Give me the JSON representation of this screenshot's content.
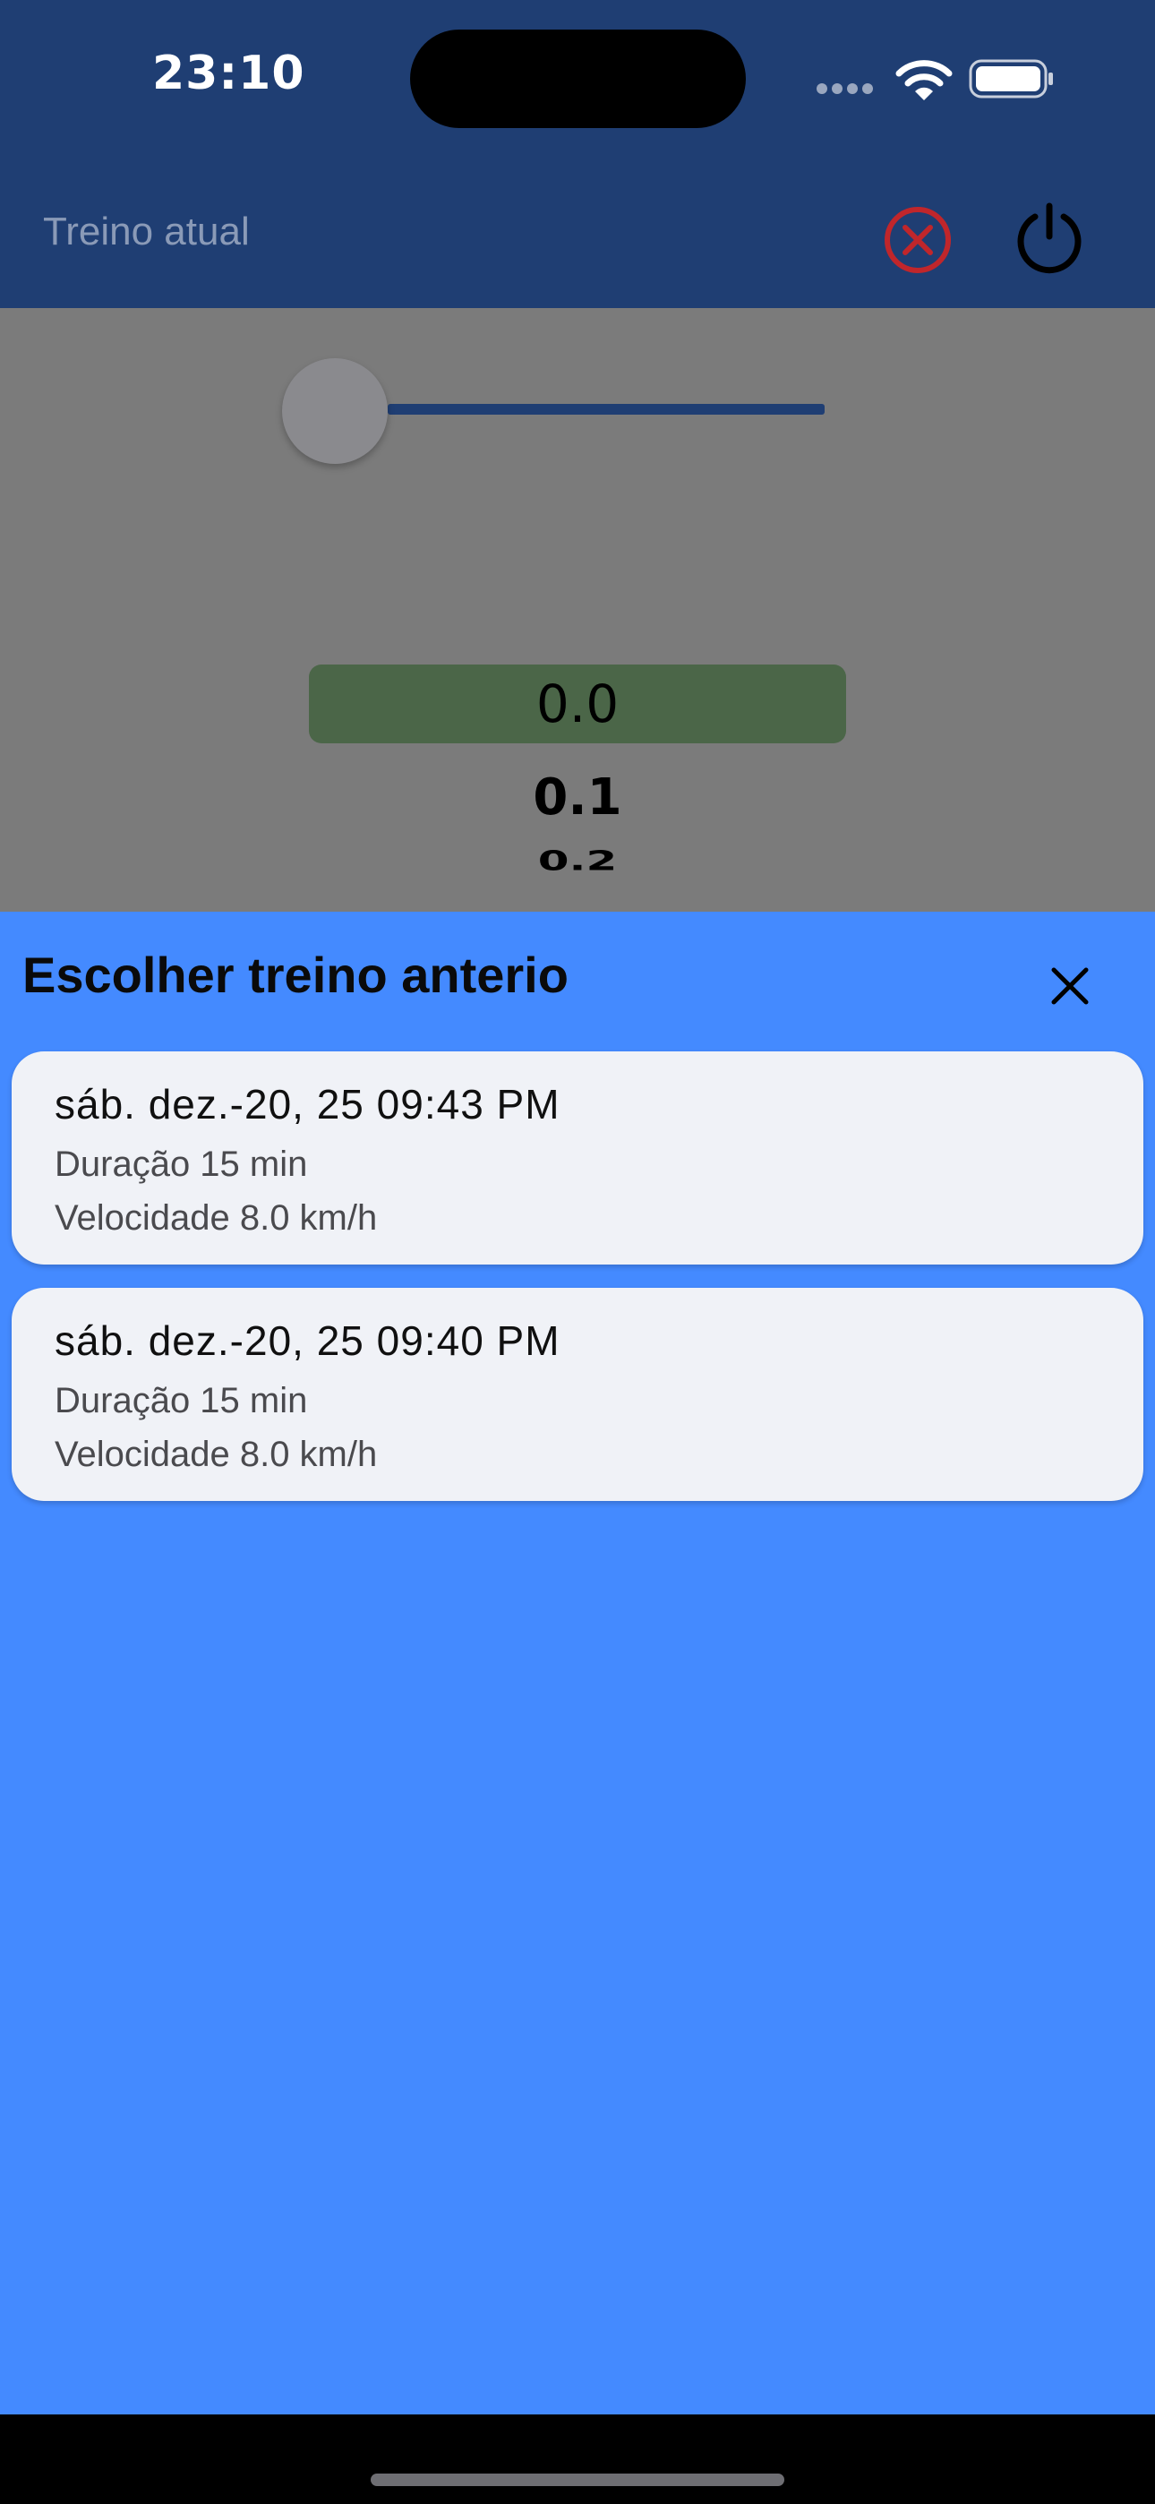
{
  "status_bar": {
    "time": "23:10"
  },
  "header": {
    "title": "Treino atual"
  },
  "picker": {
    "selected": "0.0",
    "next": "0.1",
    "next2": "0.2"
  },
  "sheet": {
    "title": "Escolher treino anterio",
    "workouts": [
      {
        "date": "sáb. dez.-20, 25 09:43 PM",
        "duration": "Duração 15 min",
        "speed": "Velocidade 8.0 km/h"
      },
      {
        "date": "sáb. dez.-20, 25 09:40 PM",
        "duration": "Duração 15 min",
        "speed": "Velocidade 8.0 km/h"
      }
    ]
  },
  "colors": {
    "header_bg": "#1f3e73",
    "sheet_bg": "#448aff",
    "card_bg": "#f0f2f7",
    "cancel_red": "#c0262b",
    "picker_selected_bg": "#4b6648"
  },
  "icons": {
    "wifi": "wifi-icon",
    "battery": "battery-icon",
    "cancel": "cancel-circle-icon",
    "power": "power-icon",
    "close": "close-icon"
  }
}
